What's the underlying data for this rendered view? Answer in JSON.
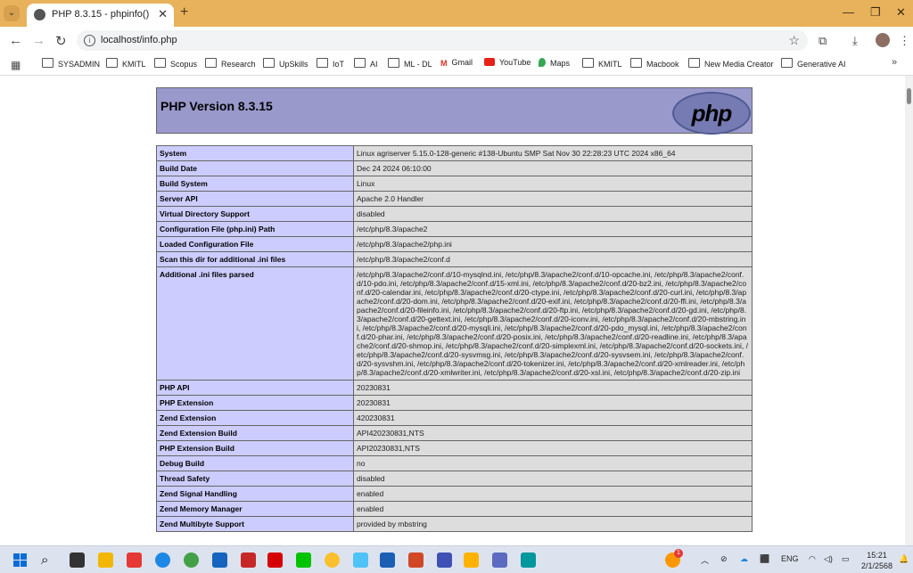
{
  "browser": {
    "tab_title": "PHP 8.3.15 - phpinfo()",
    "url": "localhost/info.php",
    "bookmarks": [
      "SYSADMIN",
      "KMITL",
      "Scopus",
      "Research",
      "UpSkills",
      "IoT",
      "AI",
      "ML - DL",
      "Gmail",
      "YouTube",
      "Maps",
      "KMITL",
      "Macbook",
      "New Media Creator",
      "Generative AI"
    ]
  },
  "php": {
    "title": "PHP Version 8.3.15",
    "logo_text": "php",
    "rows": [
      {
        "k": "System",
        "v": "Linux agriserver 5.15.0-128-generic #138-Ubuntu SMP Sat Nov 30 22:28:23 UTC 2024 x86_64"
      },
      {
        "k": "Build Date",
        "v": "Dec 24 2024 06:10:00"
      },
      {
        "k": "Build System",
        "v": "Linux"
      },
      {
        "k": "Server API",
        "v": "Apache 2.0 Handler"
      },
      {
        "k": "Virtual Directory Support",
        "v": "disabled"
      },
      {
        "k": "Configuration File (php.ini) Path",
        "v": "/etc/php/8.3/apache2"
      },
      {
        "k": "Loaded Configuration File",
        "v": "/etc/php/8.3/apache2/php.ini"
      },
      {
        "k": "Scan this dir for additional .ini files",
        "v": "/etc/php/8.3/apache2/conf.d"
      },
      {
        "k": "Additional .ini files parsed",
        "v": "/etc/php/8.3/apache2/conf.d/10-mysqlnd.ini, /etc/php/8.3/apache2/conf.d/10-opcache.ini, /etc/php/8.3/apache2/conf.d/10-pdo.ini, /etc/php/8.3/apache2/conf.d/15-xml.ini, /etc/php/8.3/apache2/conf.d/20-bz2.ini, /etc/php/8.3/apache2/conf.d/20-calendar.ini, /etc/php/8.3/apache2/conf.d/20-ctype.ini, /etc/php/8.3/apache2/conf.d/20-curl.ini, /etc/php/8.3/apache2/conf.d/20-dom.ini, /etc/php/8.3/apache2/conf.d/20-exif.ini, /etc/php/8.3/apache2/conf.d/20-ffi.ini, /etc/php/8.3/apache2/conf.d/20-fileinfo.ini, /etc/php/8.3/apache2/conf.d/20-ftp.ini, /etc/php/8.3/apache2/conf.d/20-gd.ini, /etc/php/8.3/apache2/conf.d/20-gettext.ini, /etc/php/8.3/apache2/conf.d/20-iconv.ini, /etc/php/8.3/apache2/conf.d/20-mbstring.ini, /etc/php/8.3/apache2/conf.d/20-mysqli.ini, /etc/php/8.3/apache2/conf.d/20-pdo_mysql.ini, /etc/php/8.3/apache2/conf.d/20-phar.ini, /etc/php/8.3/apache2/conf.d/20-posix.ini, /etc/php/8.3/apache2/conf.d/20-readline.ini, /etc/php/8.3/apache2/conf.d/20-shmop.ini, /etc/php/8.3/apache2/conf.d/20-simplexml.ini, /etc/php/8.3/apache2/conf.d/20-sockets.ini, /etc/php/8.3/apache2/conf.d/20-sysvmsg.ini, /etc/php/8.3/apache2/conf.d/20-sysvsem.ini, /etc/php/8.3/apache2/conf.d/20-sysvshm.ini, /etc/php/8.3/apache2/conf.d/20-tokenizer.ini, /etc/php/8.3/apache2/conf.d/20-xmlreader.ini, /etc/php/8.3/apache2/conf.d/20-xmlwriter.ini, /etc/php/8.3/apache2/conf.d/20-xsl.ini, /etc/php/8.3/apache2/conf.d/20-zip.ini"
      },
      {
        "k": "PHP API",
        "v": "20230831"
      },
      {
        "k": "PHP Extension",
        "v": "20230831"
      },
      {
        "k": "Zend Extension",
        "v": "420230831"
      },
      {
        "k": "Zend Extension Build",
        "v": "API420230831,NTS"
      },
      {
        "k": "PHP Extension Build",
        "v": "API20230831,NTS"
      },
      {
        "k": "Debug Build",
        "v": "no"
      },
      {
        "k": "Thread Safety",
        "v": "disabled"
      },
      {
        "k": "Zend Signal Handling",
        "v": "enabled"
      },
      {
        "k": "Zend Memory Manager",
        "v": "enabled"
      },
      {
        "k": "Zend Multibyte Support",
        "v": "provided by mbstring"
      }
    ]
  },
  "taskbar": {
    "language": "ENG",
    "time": "15:21",
    "date": "2/1/2568",
    "notification_count": "1"
  }
}
